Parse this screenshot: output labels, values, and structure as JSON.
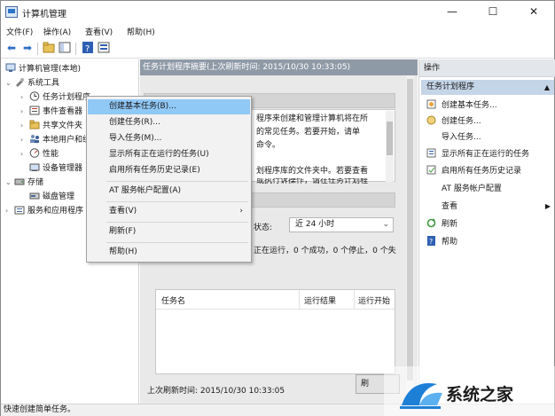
{
  "window": {
    "title": "计算机管理",
    "controls": {
      "minimize": "—",
      "maximize": "☐",
      "close": "✕"
    }
  },
  "menubar": {
    "items": [
      "文件(F)",
      "操作(A)",
      "查看(V)",
      "帮助(H)"
    ]
  },
  "tree": {
    "root": "计算机管理(本地)",
    "system_tools": "系统工具",
    "task_scheduler": "任务计划程序",
    "event_viewer": "事件查看器",
    "shared_folders": "共享文件夹",
    "local_users": "本地用户和组",
    "performance": "性能",
    "device_manager": "设备管理器",
    "storage": "存储",
    "disk_management": "磁盘管理",
    "services_apps": "服务和应用程序"
  },
  "center": {
    "header": "任务计划程序摘要(上次刷新时间: 2015/10/30 10:33:05)",
    "overview_text": [
      "程序来创建和管理计算机将在所",
      "的常见任务。若要开始，请单",
      "命令。"
    ],
    "folder_text": [
      "划程序库的文件夹中。若要查看",
      "或执行诉操作，请在任务计划程"
    ],
    "status_label": "状态:",
    "time_range": "近 24 小时",
    "summary": "正在运行，0 个成功，0 个停止，0 个失",
    "columns": [
      "任务名",
      "运行结果",
      "运行开始"
    ],
    "last_refresh": "上次刷新时间: 2015/10/30 10:33:05",
    "refresh_button": "刷"
  },
  "actions": {
    "title": "操作",
    "section": "任务计划程序",
    "items": [
      {
        "label": "创建基本任务...",
        "icon": "create-basic-task-icon"
      },
      {
        "label": "创建任务...",
        "icon": "create-task-icon"
      },
      {
        "label": "导入任务...",
        "icon": ""
      },
      {
        "label": "显示所有正在运行的任务",
        "icon": "running-tasks-icon"
      },
      {
        "label": "启用所有任务历史记录",
        "icon": "history-icon"
      },
      {
        "label": "AT 服务帐户配置",
        "icon": ""
      },
      {
        "label": "查看",
        "icon": ""
      },
      {
        "label": "刷新",
        "icon": "refresh-icon"
      },
      {
        "label": "帮助",
        "icon": "help-icon"
      }
    ]
  },
  "context_menu": {
    "items": [
      "创建基本任务(B)...",
      "创建任务(R)...",
      "导入任务(M)...",
      "显示所有正在运行的任务(U)",
      "启用所有任务历史记录(E)",
      "AT 服务帐户配置(A)",
      "查看(V)",
      "刷新(F)",
      "帮助(H)"
    ]
  },
  "statusbar": {
    "text": "快速创建简单任务。"
  },
  "watermark": {
    "text": "系统之家"
  },
  "colors": {
    "center_header": "#8f9aa7",
    "highlight": "#90c8f6",
    "actions_section": "#c5d5e8"
  }
}
